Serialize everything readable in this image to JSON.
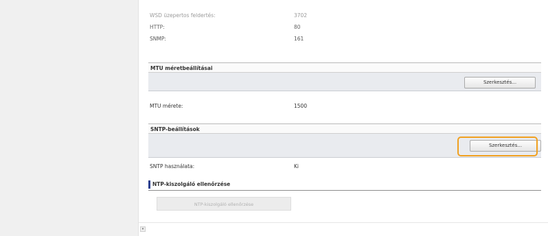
{
  "top_rows": [
    {
      "label": "WSD üzepertos feldertés:",
      "value": "3702"
    },
    {
      "label": "HTTP:",
      "value": "80"
    },
    {
      "label": "SNMP:",
      "value": "161"
    }
  ],
  "mtu": {
    "title": "MTU méretbeállításai",
    "edit_label": "Szerkesztés...",
    "row_label": "MTU mérete:",
    "row_value": "1500"
  },
  "sntp": {
    "title": "SNTP-beállítások",
    "edit_label": "Szerkesztés...",
    "row_label": "SNTP használata:",
    "row_value": "Ki",
    "ntp_check_title": "NTP-kiszolgáló ellenőrzése",
    "ntp_check_button": "NTP-kiszolgáló ellenőrzése"
  },
  "colors": {
    "highlight": "#f0a020",
    "subhead_accent": "#2a3f8f",
    "section_bar": "#e9ebef"
  },
  "icons": {
    "scroll": "scroll-toggle-icon"
  }
}
